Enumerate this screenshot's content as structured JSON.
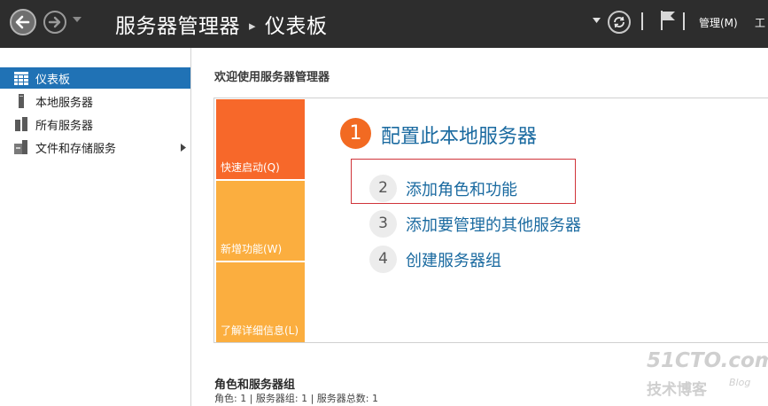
{
  "titlebar": {
    "title": "服务器管理器",
    "separator": "▸",
    "current_page": "仪表板",
    "menu_manage": "管理(M)",
    "menu_tools": "工"
  },
  "sidebar": {
    "items": [
      {
        "label": "仪表板",
        "icon": "dashboard-icon",
        "active": true
      },
      {
        "label": "本地服务器",
        "icon": "local-server-icon",
        "active": false
      },
      {
        "label": "所有服务器",
        "icon": "all-servers-icon",
        "active": false
      },
      {
        "label": "文件和存储服务",
        "icon": "file-storage-icon",
        "active": false
      }
    ]
  },
  "main": {
    "welcome": "欢迎使用服务器管理器",
    "tiles": {
      "quick_start": "快速启动(Q)",
      "new_features": "新增功能(W)",
      "learn_more": "了解详细信息(L)"
    },
    "steps": [
      {
        "number": "1",
        "label": "配置此本地服务器"
      },
      {
        "number": "2",
        "label": "添加角色和功能"
      },
      {
        "number": "3",
        "label": "添加要管理的其他服务器"
      },
      {
        "number": "4",
        "label": "创建服务器组"
      }
    ],
    "roles_title": "角色和服务器组",
    "roles_stats": "角色: 1 | 服务器组: 1 | 服务器总数: 1"
  },
  "watermark": {
    "line1": "51CTO.com",
    "line2": "技术博客",
    "line3": "Blog"
  },
  "colors": {
    "titlebar_bg": "#2d2d2d",
    "sidebar_active": "#2072b5",
    "tile_orange": "#f7682a",
    "tile_amber": "#fbae3f",
    "link_blue": "#1a6aa0",
    "highlight_red": "#d0343a"
  }
}
